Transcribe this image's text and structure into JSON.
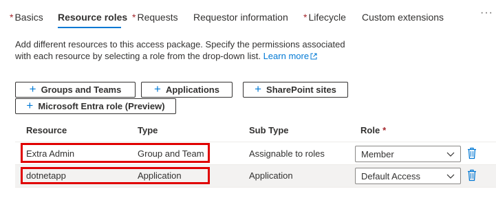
{
  "tabs": [
    {
      "label": "Basics",
      "required": true,
      "active": false
    },
    {
      "label": "Resource roles",
      "required": false,
      "active": true
    },
    {
      "label": "Requests",
      "required": true,
      "active": false
    },
    {
      "label": "Requestor information",
      "required": false,
      "active": false
    },
    {
      "label": "Lifecycle",
      "required": true,
      "active": false
    },
    {
      "label": "Custom extensions",
      "required": false,
      "active": false
    }
  ],
  "required_marker": "*",
  "more_label": "···",
  "description": {
    "text": "Add different resources to this access package. Specify the permissions associated with each resource by selecting a role from the drop-down list.",
    "link": "Learn more"
  },
  "buttons": {
    "groups": "Groups and Teams",
    "applications": "Applications",
    "sharepoint": "SharePoint sites",
    "entra": "Microsoft Entra role (Preview)",
    "plus": "+"
  },
  "table": {
    "headers": {
      "resource": "Resource",
      "type": "Type",
      "subtype": "Sub Type",
      "role": "Role"
    },
    "rows": [
      {
        "resource": "Extra Admin",
        "type": "Group and Team",
        "subtype": "Assignable to roles",
        "role": "Member"
      },
      {
        "resource": "dotnetapp",
        "type": "Application",
        "subtype": "Application",
        "role": "Default Access"
      }
    ]
  },
  "colors": {
    "accent": "#0078d4",
    "required": "#a4262c",
    "highlight": "#e00000",
    "selected_row": "#f3f2f1"
  },
  "icons": [
    "external-link-icon",
    "plus-icon",
    "chevron-down-icon",
    "trash-icon"
  ]
}
